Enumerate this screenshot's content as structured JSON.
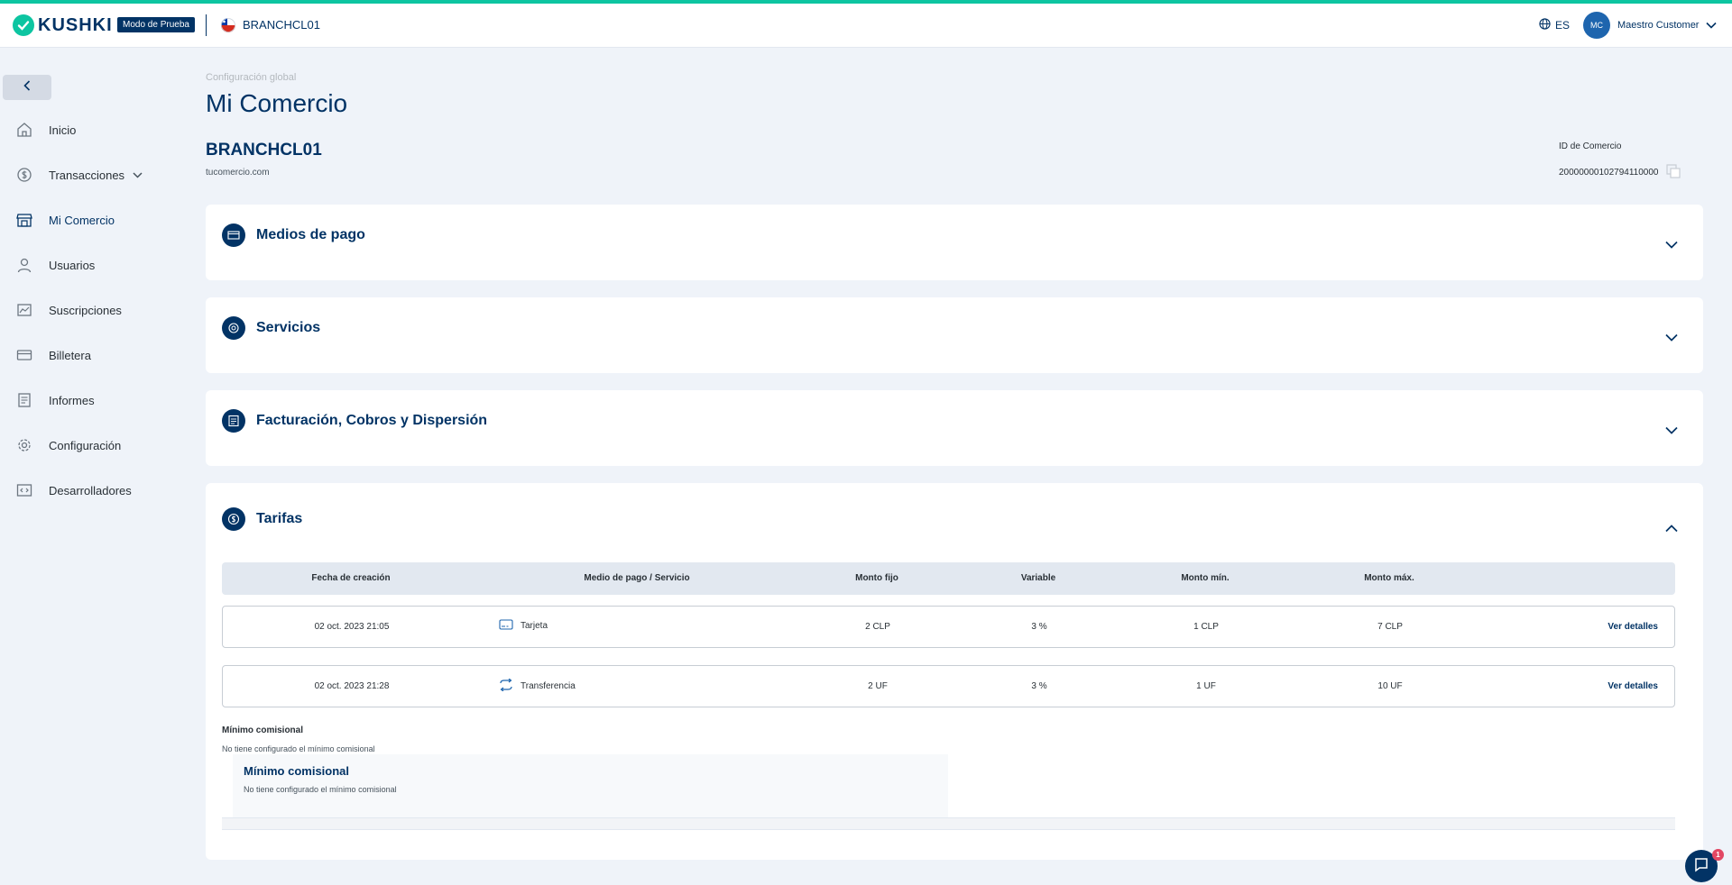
{
  "topbar": {
    "brand": "KUSHKI",
    "test_badge": "Modo de Prueba",
    "merchant": "BRANCHCL01",
    "language": "ES",
    "user_initials": "MC",
    "user_name": "Maestro Customer"
  },
  "sidebar": {
    "items": [
      {
        "label": "Inicio",
        "icon": "home-icon"
      },
      {
        "label": "Transacciones",
        "icon": "dollar-circle-icon"
      },
      {
        "label": "Mi Comercio",
        "icon": "store-icon"
      },
      {
        "label": "Usuarios",
        "icon": "user-icon"
      },
      {
        "label": "Suscripciones",
        "icon": "subscriptions-icon"
      },
      {
        "label": "Billetera",
        "icon": "wallet-icon"
      },
      {
        "label": "Informes",
        "icon": "report-icon"
      },
      {
        "label": "Configuración",
        "icon": "gear-icon"
      },
      {
        "label": "Desarrolladores",
        "icon": "code-icon"
      }
    ],
    "active": "Mi Comercio"
  },
  "main": {
    "breadcrumb": "Configuración global",
    "title": "Mi Comercio",
    "merchant_name": "BRANCHCL01",
    "merchant_site": "tucomercio.com",
    "id_label": "ID de Comercio",
    "id_value": "20000000102794110000",
    "sections": [
      {
        "title": "Medios de pago",
        "icon": "card-icon"
      },
      {
        "title": "Servicios",
        "icon": "services-icon"
      },
      {
        "title": "Facturación, Cobros y Dispersión",
        "icon": "billing-icon"
      },
      {
        "title": "Tarifas",
        "icon": "dollar-circle-icon"
      }
    ],
    "rates": {
      "columns": [
        "Fecha de creación",
        "Medio de pago / Servicio",
        "Monto fijo",
        "Variable",
        "Monto mín.",
        "Monto máx."
      ],
      "rows": [
        {
          "date": "02 oct. 2023 21:05",
          "method": "Tarjeta",
          "method_icon": "credit-card-icon",
          "fixed": "2 CLP",
          "variable": "3 %",
          "min": "1 CLP",
          "max": "7 CLP",
          "link": "Ver detalles"
        },
        {
          "date": "02 oct. 2023 21:28",
          "method": "Transferencia",
          "method_icon": "transfer-icon",
          "fixed": "2 UF",
          "variable": "3 %",
          "min": "1 UF",
          "max": "10 UF",
          "link": "Ver detalles"
        }
      ],
      "min_title": "Mínimo comisional",
      "min_sub": "No tiene configurado el mínimo comisional",
      "min_box_title": "Mínimo comisional",
      "min_box_sub": "No tiene configurado el mínimo comisional"
    }
  },
  "chat": {
    "badge": "1"
  },
  "colors": {
    "accent": "#0dc5a1",
    "primary": "#023365",
    "background": "#eff3f9"
  }
}
